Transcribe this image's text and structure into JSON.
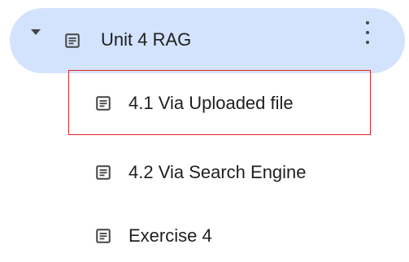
{
  "outline": {
    "parent": {
      "label": "Unit 4 RAG",
      "expanded": true,
      "icon": "document-icon",
      "menu_icon": "more-vert-icon"
    },
    "children": [
      {
        "label": "4.1 Via Uploaded file",
        "icon": "document-icon",
        "highlighted": true
      },
      {
        "label": "4.2 Via Search Engine",
        "icon": "document-icon"
      },
      {
        "label": "Exercise 4",
        "icon": "document-icon"
      }
    ]
  },
  "colors": {
    "selected_bg": "#d3e3fd",
    "text": "#1f1f1f",
    "icon": "#444746",
    "highlight_border": "#e02424"
  }
}
